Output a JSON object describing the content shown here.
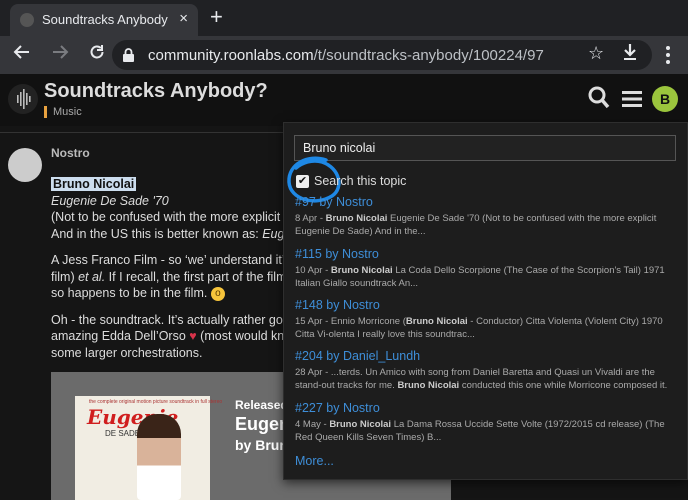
{
  "browser": {
    "tab_title": "Soundtracks Anybody? - Music",
    "tab_close": "×",
    "new_tab": "+",
    "url_host": "community.roonlabs.com",
    "url_path": "/t/soundtracks-anybody/100224/97"
  },
  "header": {
    "title": "Soundtracks Anybody?",
    "category": "Music",
    "category_color": "#e8a240",
    "avatar_letter": "B",
    "avatar_color": "#9bc53d"
  },
  "post": {
    "author": "Nostro",
    "highlight": "Bruno Nicolai",
    "album_title_italic": "Eugenie De Sade '70",
    "line1": "(Not to be confused with the more explicit Eu",
    "line2_a": "And in the US this is better known as: ",
    "line2_b": "Eugeni",
    "p2_line1": "A Jess Franco Film - so ‘we’ understand it’s a",
    "p2_line2_a": "film) ",
    "p2_line2_b": "et al.",
    "p2_line2_c": " If I recall, the first part of the film a",
    "p2_line3": "so happens to be in the film.",
    "p3_line1": "Oh - the soundtrack. It’s actually rather good",
    "p3_line2_a": "amazing Edda Dell’Orso ",
    "p3_line2_b": " (most would kno",
    "p3_line3": "some larger orchestrations.",
    "album_art": {
      "small_text": "the complete original motion picture soundtrack in full stereo",
      "title": "Eugenie",
      "subtitle": "DE SADE '70"
    },
    "album_overlay": {
      "line1": "Released",
      "line2": "Eugen",
      "line3_a": "by ",
      "line3_b": "Brun"
    }
  },
  "search_panel": {
    "query": "Bruno nicolai",
    "checkbox_label": "Search this topic",
    "checkbox_checked": true,
    "results": [
      {
        "link": "#97 by Nostro",
        "snippet_pre": "8 Apr - ",
        "snippet_bold": "Bruno Nicolai",
        "snippet_post": " Eugenie De Sade '70 (Not to be confused with the more explicit Eugenie De Sade) And in the..."
      },
      {
        "link": "#115 by Nostro",
        "snippet_pre": "10 Apr - ",
        "snippet_bold": "Bruno Nicolai",
        "snippet_post": " La Coda Dello Scorpione (The Case of the Scorpion's Tail) 1971 Italian Giallo soundtrack An..."
      },
      {
        "link": "#148 by Nostro",
        "snippet_pre": "15 Apr - Ennio Morricone (",
        "snippet_bold": "Bruno Nicolai",
        "snippet_post": " - Conductor) Citta Violenta (Violent City) 1970 Citta Vi-olenta I really love this soundtrac..."
      },
      {
        "link": "#204 by Daniel_Lundh",
        "snippet_pre": "28 Apr - ...terds. Un Amico with song from Daniel Baretta and Quasi un Vivaldi are the stand-out tracks for me. ",
        "snippet_bold": "Bruno Nicolai",
        "snippet_post": " conducted this one while Morricone composed it."
      },
      {
        "link": "#227 by Nostro",
        "snippet_pre": "4 May - ",
        "snippet_bold": "Bruno Nicolai",
        "snippet_post": " La Dama Rossa Uccide Sette Volte (1972/2015 cd release) (The Red Queen Kills Seven Times) B..."
      }
    ],
    "more": "More..."
  }
}
